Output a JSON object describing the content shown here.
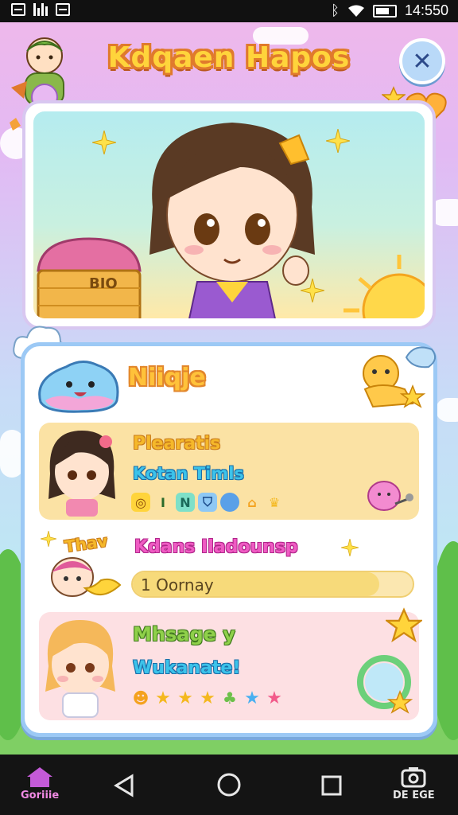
{
  "status_bar": {
    "time": "14:550",
    "icons": [
      "notification-icon",
      "signal-icon",
      "image-icon",
      "bluetooth-icon",
      "wifi-icon",
      "battery-icon"
    ]
  },
  "header": {
    "title": "Kdqaen Hapos",
    "close_icon": "close-icon"
  },
  "hero": {
    "chest_label": "BIO"
  },
  "card": {
    "title": "Niiqje",
    "row1": {
      "line1": "Plearatis",
      "line2": "Kotan Timls",
      "icons": [
        "ring-icon",
        "I",
        "N",
        "shield-icon",
        "egg-icon",
        "house-icon",
        "crown-icon"
      ]
    },
    "row2": {
      "badge": "Thav",
      "line1": "Kdans Iladounsp",
      "progress_text": "1 Oornay",
      "progress_value": 0.88
    },
    "row3": {
      "line1": "Mhsage y",
      "line2": "Wukanate!",
      "icons": [
        "smile-icon",
        "star-icon",
        "star-icon",
        "star-icon",
        "leaf-icon",
        "star-icon",
        "star-icon"
      ]
    }
  },
  "navbar": {
    "home_label": "Goriiie",
    "right_label": "DE EGE"
  },
  "colors": {
    "title_yellow": "#ffd43b",
    "card_border": "#9cc9f5",
    "row1_bg": "#fbe2a4",
    "row3_bg": "#fde0e3",
    "nav_active": "#f08ae3"
  }
}
